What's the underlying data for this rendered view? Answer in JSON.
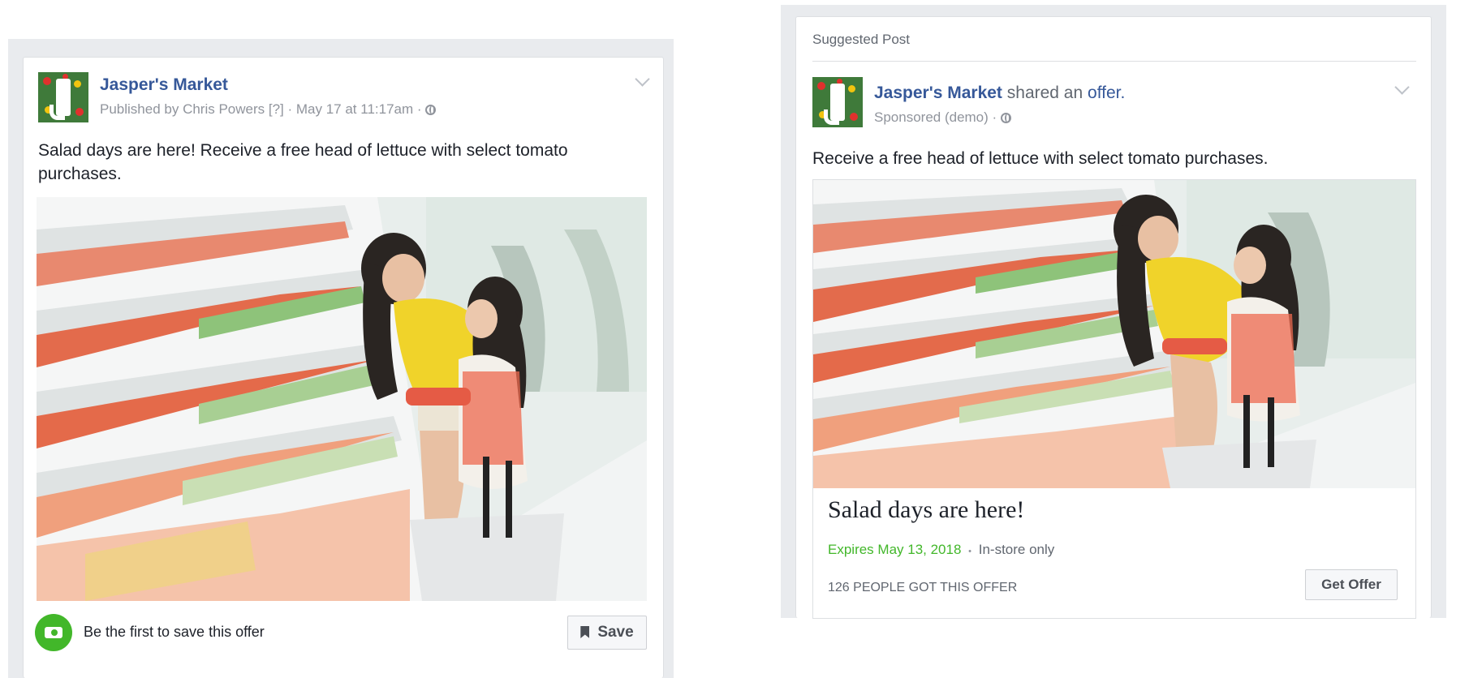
{
  "left_post": {
    "page_name": "Jasper's Market",
    "published_by": "Published by Chris Powers [?] · May 17 at 11:17am ·",
    "body": "Salad days are here! Receive a free head of lettuce with select tomato purchases.",
    "footer_text": "Be the first to save this offer",
    "save_label": "Save",
    "icons": [
      "avatar-logo",
      "chevron-down-icon",
      "globe-icon",
      "offer-icon",
      "bookmark-icon"
    ]
  },
  "right_post": {
    "header_label": "Suggested Post",
    "page_name": "Jasper's Market",
    "shared_text": "shared an",
    "offer_word": "offer.",
    "sponsored": "Sponsored (demo) ·",
    "body": "Receive a free head of lettuce with select tomato purchases.",
    "offer_title": "Salad days are here!",
    "expires": "Expires May 13, 2018",
    "separator": "•",
    "availability": "In-store only",
    "people_count": "126 PEOPLE GOT THIS OFFER",
    "get_offer_label": "Get Offer",
    "icons": [
      "avatar-logo",
      "chevron-down-icon",
      "globe-icon"
    ]
  },
  "colors": {
    "link": "#365899",
    "expires_green": "#42b72a",
    "offer_badge": "#42b72a",
    "frame_gray": "#e9ebee"
  }
}
